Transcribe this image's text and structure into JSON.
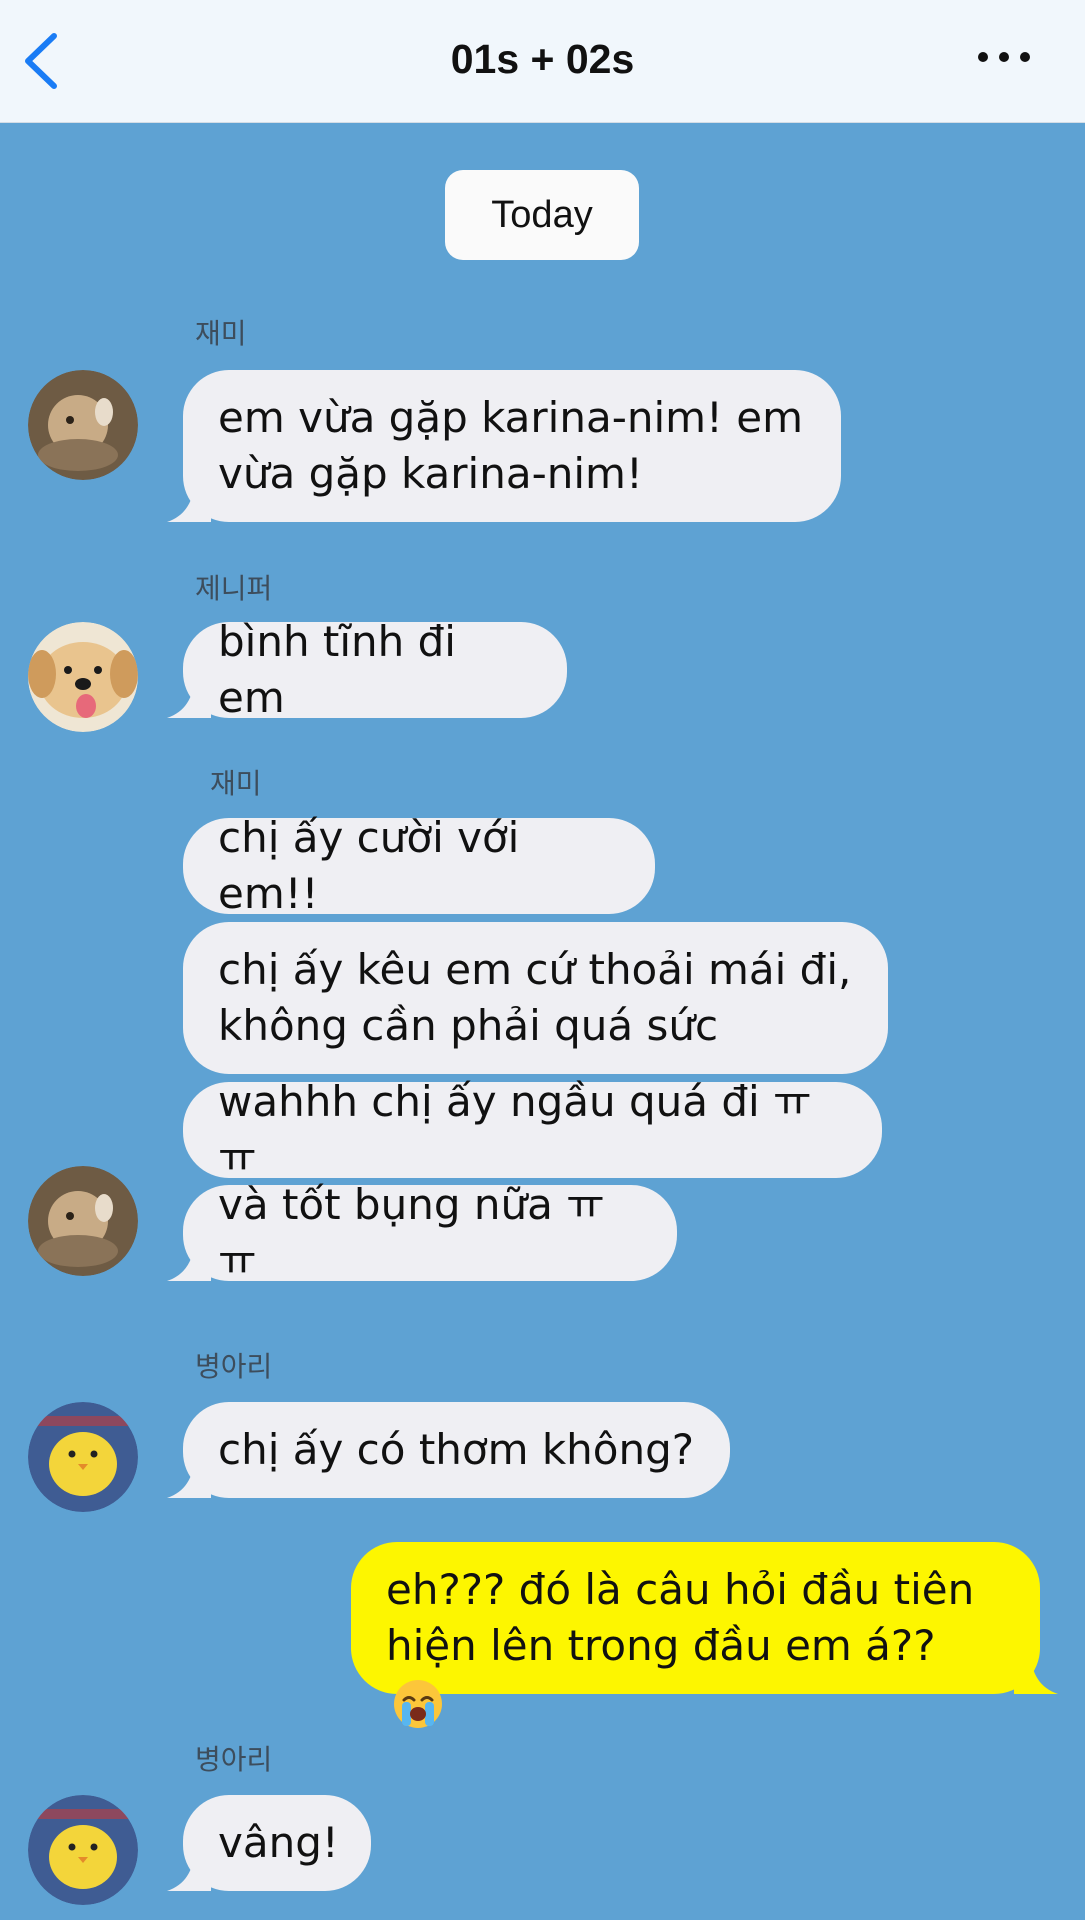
{
  "header": {
    "title": "01s + 02s"
  },
  "date_chip": "Today",
  "senders": {
    "s1": "재미",
    "s2": "제니퍼",
    "s3": "재미",
    "s4": "병아리",
    "s5": "병아리"
  },
  "messages": {
    "m1": "em vừa gặp karina-nim! em\nvừa gặp karina-nim!",
    "m2": "bình tĩnh đi em",
    "m3": "chị ấy cười với em!!",
    "m4": "chị ấy kêu em cứ thoải mái đi,\nkhông cần phải quá sức",
    "m5": "wahhh chị ấy ngầu quá đi ㅠㅠ",
    "m6": "và tốt bụng nữa ㅠㅠ",
    "m7": "chị ấy có thơm không?",
    "m8": "eh??? đó là câu hỏi đầu tiên\nhiện lên trong đầu em á??",
    "m9": "vâng!"
  },
  "icons": {
    "back": "chevron-left-icon",
    "more": "more-dots-icon",
    "emoji": "loudly-crying-face-emoji"
  },
  "colors": {
    "background": "#5ea2d3",
    "header": "#f1f7fc",
    "accent": "#1a7cf5",
    "bubble_other": "#efeff3",
    "bubble_mine": "#fdf600"
  }
}
